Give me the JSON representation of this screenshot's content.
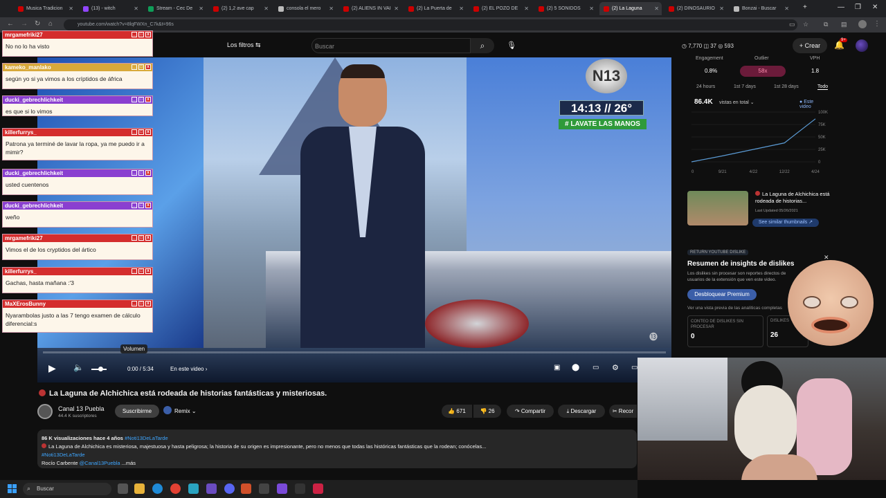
{
  "tabs": [
    {
      "label": "Musica Tradicion",
      "color": "#cc0000"
    },
    {
      "label": "(13) - witch",
      "color": "#9146ff"
    },
    {
      "label": "Stream - Cec De",
      "color": "#0f9d58"
    },
    {
      "label": "(2) 1,2 ave cap",
      "color": "#cc0000"
    },
    {
      "label": "consola el mero",
      "color": "#bbbbbb"
    },
    {
      "label": "(2) ALIENS IN VAI",
      "color": "#cc0000"
    },
    {
      "label": "(2) La Puerta de",
      "color": "#cc0000"
    },
    {
      "label": "(2) EL POZO DE",
      "color": "#cc0000"
    },
    {
      "label": "(2) 5 SONIDOS",
      "color": "#cc0000"
    },
    {
      "label": "(2) La Laguna",
      "color": "#cc0000"
    },
    {
      "label": "(2) DINOSAURIO",
      "color": "#cc0000"
    },
    {
      "label": "Bonzai - Buscar",
      "color": "#bbbbbb"
    }
  ],
  "url": "youtube.com/watch?v=8lqFWXn_C7k&t=96s",
  "header": {
    "filters_label": "Los filtros",
    "search_placeholder": "Buscar",
    "stats": "◷ 7,770  ◫ 37  ◎ 593",
    "create_label": "+ Crear",
    "notif_count": "9+"
  },
  "video": {
    "clock_text": "14:13 // 26°",
    "banner_text": "# LAVATE LAS MANOS",
    "logo_text": "N13",
    "volume_tooltip": "Volumen",
    "time": "0:00 / 5:34",
    "chapter": "En este video ›"
  },
  "chat": [
    {
      "user": "mrgamefriki27",
      "msg": "No no lo ha visto",
      "color": "#d42d2d"
    },
    {
      "user": "kameko_manlako",
      "msg": "según yo si ya vimos a los críptidos de áfrica",
      "color": "#d8a93a"
    },
    {
      "user": "ducki_gebrechlichkeit",
      "msg": "es que si lo vimos",
      "color": "#8a3fd0"
    },
    {
      "user": "killerfurrys_",
      "msg": "Patrona ya terminé de lavar la ropa, ya me puedo ir a mimir?",
      "color": "#d42d2d"
    },
    {
      "user": "ducki_gebrechlichkeit",
      "msg": "usted cuentenos",
      "color": "#8a3fd0"
    },
    {
      "user": "ducki_gebrechlichkeit",
      "msg": "weño",
      "color": "#8a3fd0"
    },
    {
      "user": "mrgamefriki27",
      "msg": "Vimos el de los cryptidos del ártico",
      "color": "#d42d2d"
    },
    {
      "user": "killerfurrys_",
      "msg": "Gachas, hasta mañana :'3",
      "color": "#d42d2d"
    },
    {
      "user": "MaXErosBunny",
      "msg": "Nyarambolas justo a las 7 tengo examen de cálculo diferencial:s",
      "color": "#d42d2d"
    }
  ],
  "meta": {
    "title": "La Laguna de Alchichica está rodeada de historias fantásticas y misteriosas.",
    "channel": "Canal 13 Puebla",
    "subscribers": "44.4 K suscriptores",
    "subscribe_label": "Suscribirme",
    "remix_label": "Remix",
    "likes": "671",
    "dislikes": "26",
    "share_label": "Compartir",
    "download_label": "Descargar",
    "clip_label": "Recor"
  },
  "description": {
    "stats": "86 K visualizaciones  hace 4 años",
    "hashtag": "#Noti13DeLaTarde",
    "line1": "La Laguna de Alchichica es misteriosa, majestuosa y hasta peligrosa; la historia de su origen es impresionante, pero no menos que todas las históricas fantásticas que la rodean; conócelas...",
    "hashtag2": "#Noti13DeLaTarde",
    "credit": "Rocío Carbente",
    "credit_handle": "@Canal13Puebla",
    "more": "...más"
  },
  "panel": {
    "engagement_label": "Engagement",
    "engagement_value": "0.8%",
    "outlier_label": "Outlier",
    "outlier_value": "58x",
    "vph_label": "VPH",
    "vph_value": "1.8",
    "periods": [
      "24 hours",
      "1st 7 days",
      "1st 28 days",
      "Todo"
    ],
    "views_total": "86.4K",
    "views_label": "vistas en total",
    "legend_label": "Este video",
    "thumb_title": "La Laguna de Alchichica está rodeada de historias...",
    "thumb_sub": "Last Updated 05/26/2021",
    "similar_btn": "See similar thumbnails ↗",
    "dislike_section_tag": "RETURN YOUTUBE DISLIKE",
    "dislike_title": "Resumen de insights de dislikes",
    "dislike_desc": "Los dislikes sin procesar son reportes directos de usuarios de la extensión que ven este video.",
    "unlock_label": "Desbloquear Premium",
    "preview_text": "Ver una vista previa de las analíticas completas",
    "raw_label": "CONTEO DE DISLIKES SIN PROCESAR",
    "raw_value": "0",
    "dislikes_label": "DISLIKES",
    "dislikes_value": "26"
  },
  "chart_data": {
    "type": "line",
    "title": "",
    "x": [
      "0",
      "9/21",
      "4/22",
      "12/22",
      "4/24"
    ],
    "y_ticks": [
      "100K",
      "75K",
      "50K",
      "25K",
      "0"
    ],
    "ylim": [
      0,
      100000
    ],
    "series": [
      {
        "name": "Este video",
        "values": [
          0,
          12000,
          25000,
          38000,
          86400
        ]
      }
    ],
    "grid": true
  },
  "taskbar": {
    "search_label": "Buscar"
  }
}
